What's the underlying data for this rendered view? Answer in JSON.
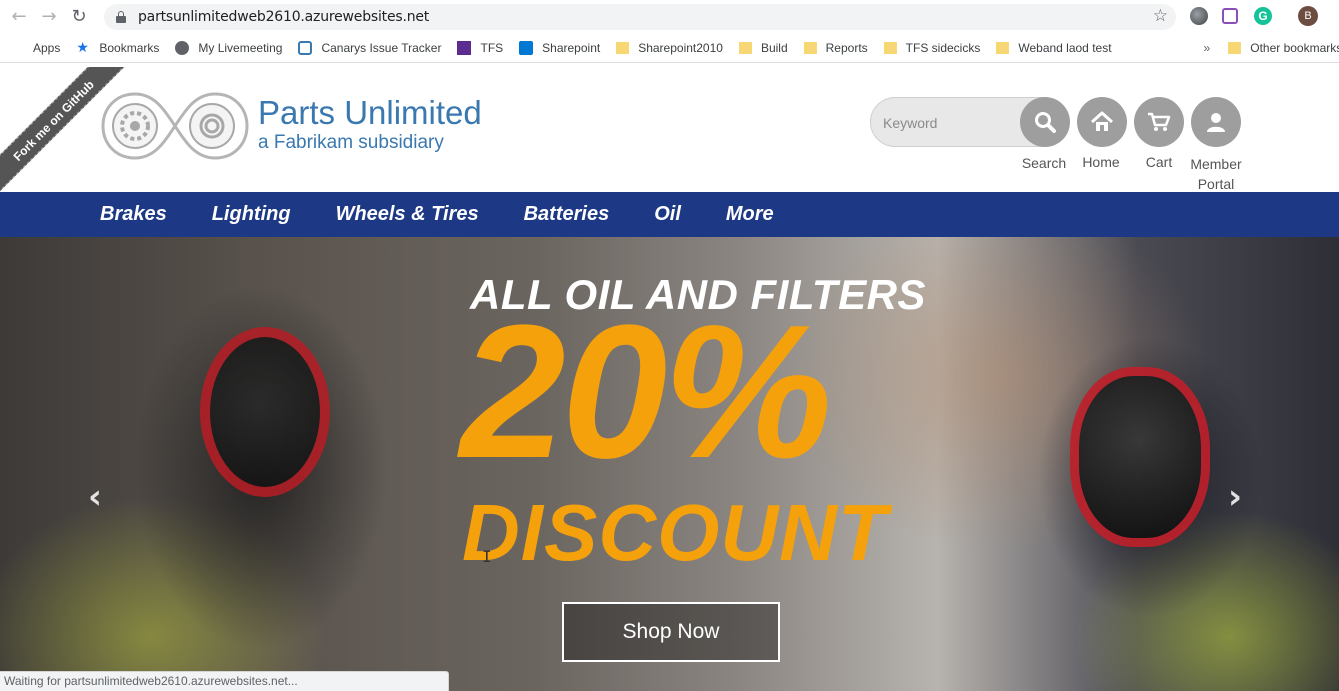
{
  "browser": {
    "url": "partsunlimitedweb2610.azurewebsites.net",
    "profile_initial": "B",
    "extension_grammarly": "G",
    "bookmarks": [
      {
        "label": "Apps",
        "icon": "apps-grid-icon"
      },
      {
        "label": "Bookmarks",
        "icon": "star-icon"
      },
      {
        "label": "My Livemeeting",
        "icon": "globe-icon"
      },
      {
        "label": "Canarys Issue Tracker",
        "icon": "tracker-icon"
      },
      {
        "label": "TFS",
        "icon": "visual-studio-icon"
      },
      {
        "label": "Sharepoint",
        "icon": "sharepoint-icon"
      },
      {
        "label": "Sharepoint2010",
        "icon": "folder-icon"
      },
      {
        "label": "Build",
        "icon": "folder-icon"
      },
      {
        "label": "Reports",
        "icon": "folder-icon"
      },
      {
        "label": "TFS sidecicks",
        "icon": "folder-icon"
      },
      {
        "label": "Weband laod test",
        "icon": "folder-icon"
      }
    ],
    "overflow": "»",
    "other_bookmarks": "Other bookmarks",
    "status_text": "Waiting for partsunlimitedweb2610.azurewebsites.net..."
  },
  "site": {
    "fork_ribbon": "Fork me on GitHub",
    "brand_title": "Parts Unlimited",
    "brand_subtitle": "a Fabrikam subsidiary",
    "search_placeholder": "Keyword",
    "header_buttons": {
      "search": "Search",
      "home": "Home",
      "cart": "Cart",
      "member": "Member Portal"
    },
    "nav": [
      "Brakes",
      "Lighting",
      "Wheels & Tires",
      "Batteries",
      "Oil",
      "More"
    ],
    "hero": {
      "headline": "ALL OIL AND FILTERS",
      "percent": "20%",
      "discount": "DISCOUNT",
      "cta": "Shop Now"
    }
  },
  "colors": {
    "brand_blue": "#3a78b0",
    "nav_bg": "#1d3885",
    "hero_accent": "#f5a10c"
  }
}
